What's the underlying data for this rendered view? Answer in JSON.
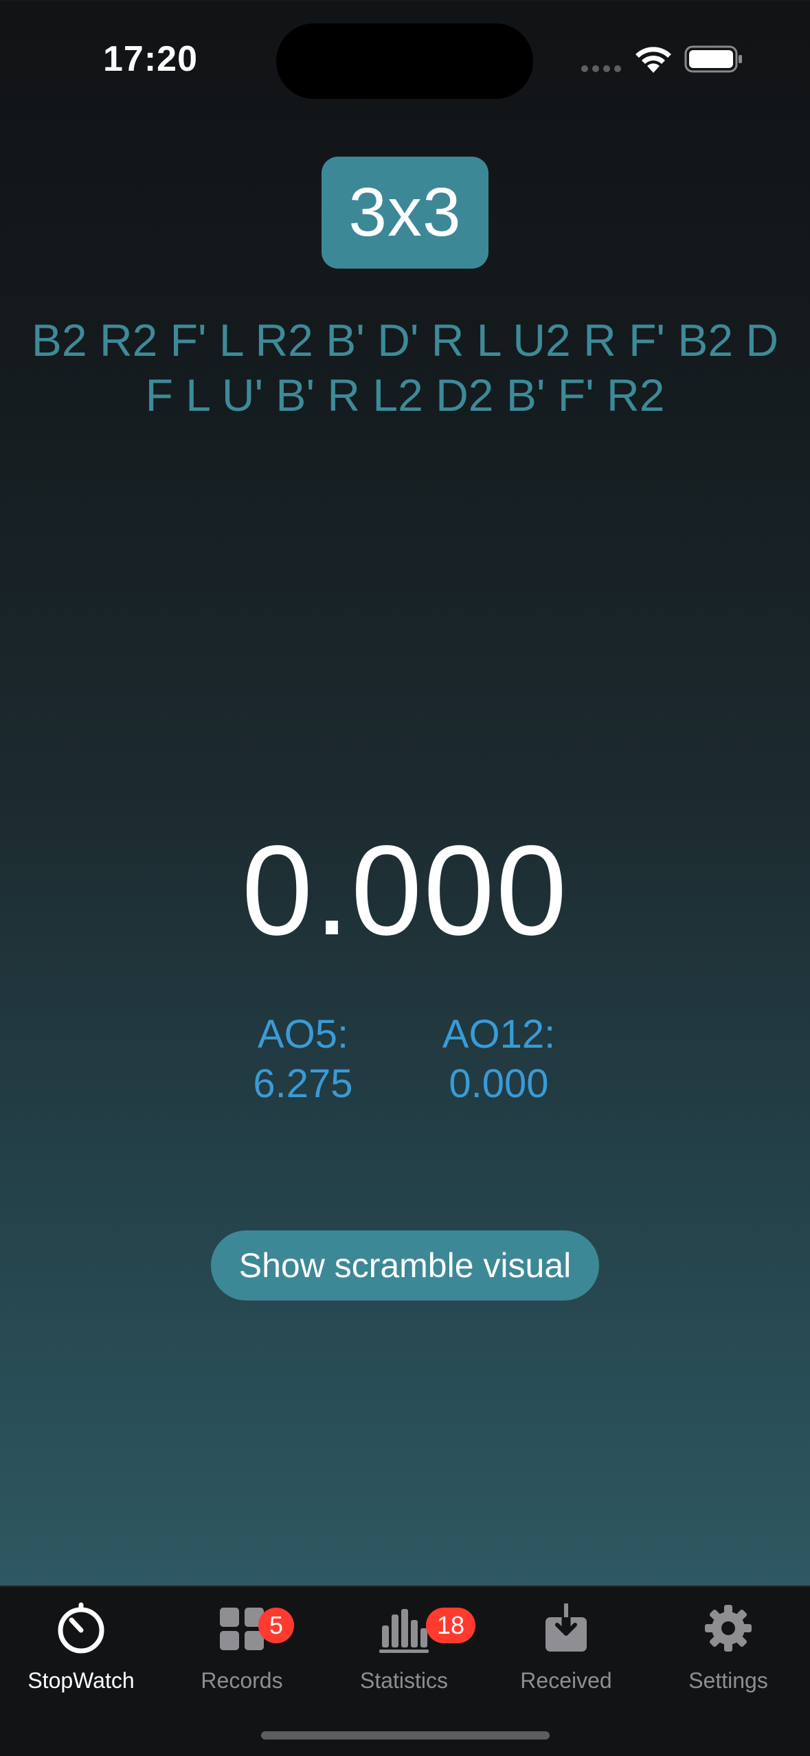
{
  "status_bar": {
    "time": "17:20"
  },
  "puzzle": {
    "label": "3x3"
  },
  "scramble": {
    "line1": "B2 R2 F' L R2 B' D' R L U2 R F' B2 D",
    "line2": "F L U' B' R L2 D2 B' F' R2"
  },
  "timer": {
    "value": "0.000"
  },
  "averages": {
    "ao5_label": "AO5:",
    "ao5_value": "6.275",
    "ao12_label": "AO12:",
    "ao12_value": "0.000"
  },
  "actions": {
    "show_scramble_visual": "Show scramble visual"
  },
  "tab_bar": {
    "tabs": [
      {
        "label": "StopWatch",
        "icon": "stopwatch-icon",
        "active": true
      },
      {
        "label": "Records",
        "icon": "grid-icon",
        "badge": "5"
      },
      {
        "label": "Statistics",
        "icon": "bar-chart-icon",
        "badge": "18"
      },
      {
        "label": "Received",
        "icon": "download-tray-icon"
      },
      {
        "label": "Settings",
        "icon": "gear-icon"
      }
    ]
  },
  "colors": {
    "accent": "#3d8896",
    "scramble_text": "#3e8a99",
    "average_text": "#3a9bd6",
    "badge": "#ff3b30"
  }
}
